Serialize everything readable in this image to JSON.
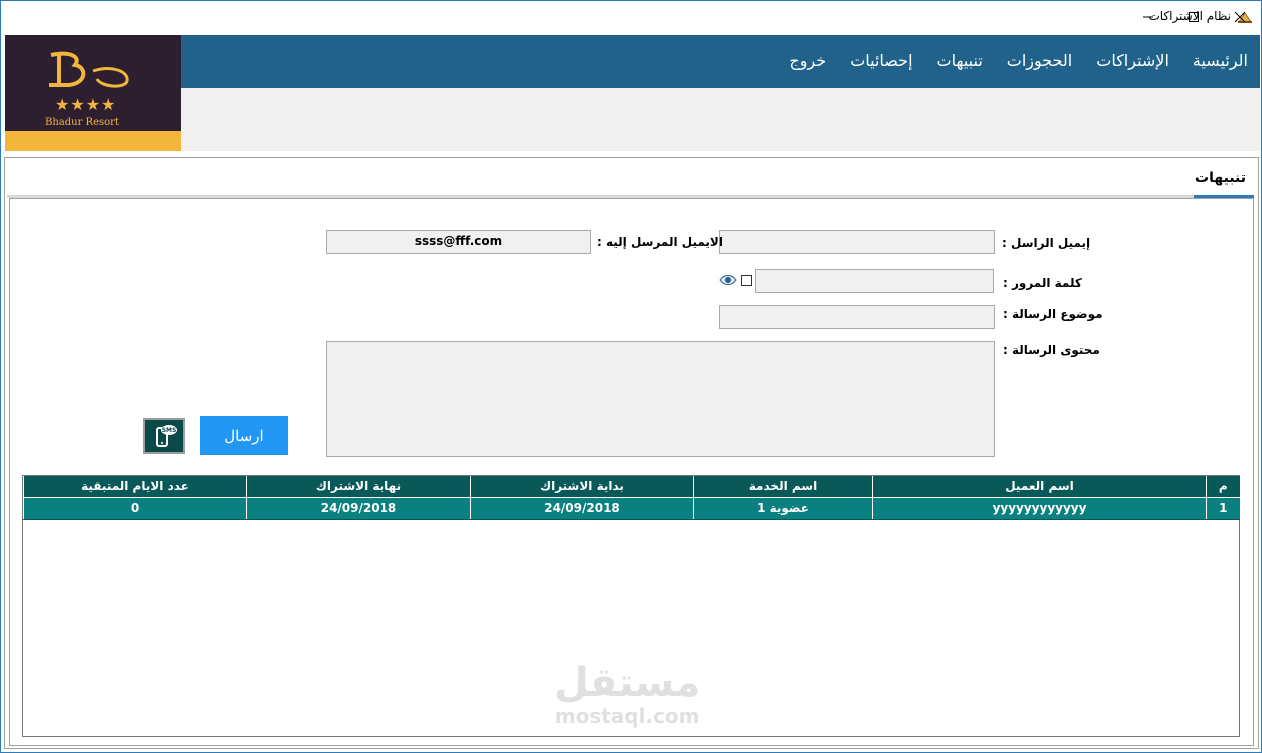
{
  "window": {
    "title": "نظام الاشتراكات"
  },
  "logo": {
    "stars": "★★★★",
    "brand_en": "Bhadur Resort"
  },
  "menu": {
    "items": [
      "الرئيسية",
      "الإشتراكات",
      "الحجوزات",
      "تنبيهات",
      "إحصائيات",
      "خروج"
    ]
  },
  "tab": {
    "label": "تنبيهات"
  },
  "form": {
    "sender_email_label": "إيميل الراسل :",
    "sender_email_value": "",
    "recipient_email_label": "الايميل المرسل إليه :",
    "recipient_email_value": "ssss@fff.com",
    "password_label": "كلمة المرور :",
    "password_value": "",
    "subject_label": "موضوع الرسالة :",
    "subject_value": "",
    "content_label": "محتوى الرسالة :",
    "content_value": "",
    "send_label": "ارسال",
    "sms_icon_text": "SMS"
  },
  "grid": {
    "columns": [
      "م",
      "اسم العميل",
      "اسم الخدمة",
      "بداية الاشتراك",
      "نهاية الاشتراك",
      "عدد الايام المتبقية"
    ],
    "rows": [
      [
        "1",
        "yyyyyyyyyyyy",
        "عضوية 1",
        "24/09/2018",
        "24/09/2018",
        "0"
      ]
    ]
  },
  "watermark": {
    "arabic": "مستقل",
    "latin": "mostaql.com"
  }
}
